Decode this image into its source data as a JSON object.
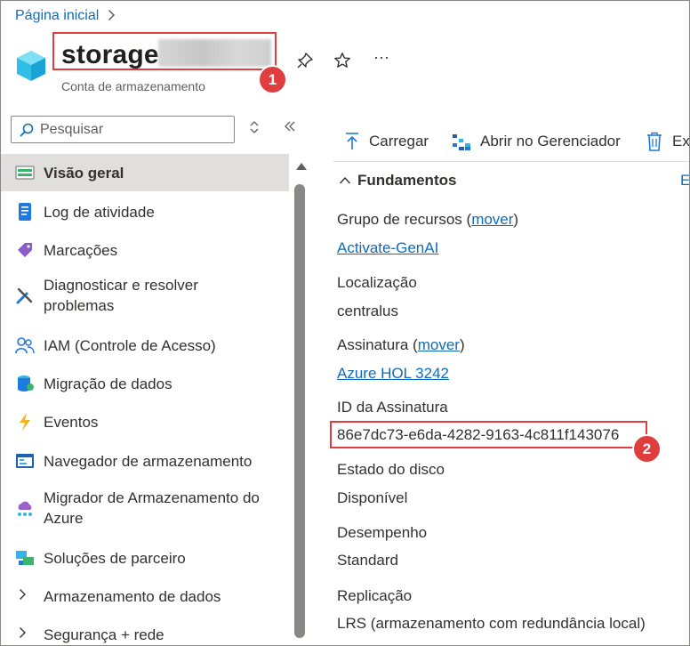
{
  "breadcrumb": {
    "home": "Página inicial"
  },
  "header": {
    "title": "storage",
    "subtitle": "Conta de armazenamento",
    "more_label": "···",
    "badges": [
      "1",
      "2"
    ]
  },
  "colors": {
    "accent": "#0f6cbd",
    "highlight": "#e03e3e",
    "active_bg": "#e1dfdd"
  },
  "sidebar": {
    "search_placeholder": "Pesquisar",
    "items": [
      {
        "label": "Visão geral",
        "icon": "overview-icon"
      },
      {
        "label": "Log de atividade",
        "icon": "activity-log-icon"
      },
      {
        "label": "Marcações",
        "icon": "tag-icon"
      },
      {
        "label": "Diagnosticar e resolver problemas",
        "icon": "wrench-icon"
      },
      {
        "label": "IAM (Controle de Acesso)",
        "icon": "people-icon"
      },
      {
        "label": "Migração de dados",
        "icon": "data-migration-icon"
      },
      {
        "label": "Eventos",
        "icon": "lightning-icon"
      },
      {
        "label": "Navegador de armazenamento",
        "icon": "storage-browser-icon"
      },
      {
        "label": "Migrador de Armazenamento do Azure",
        "icon": "cloud-migrator-icon"
      },
      {
        "label": "Soluções de parceiro",
        "icon": "partner-icon"
      },
      {
        "label": "Armazenamento de dados",
        "icon": "chevron-right-icon"
      },
      {
        "label": "Segurança + rede",
        "icon": "chevron-right-icon"
      }
    ]
  },
  "toolbar": {
    "upload": "Carregar",
    "open_explorer": "Abrir no Gerenciador",
    "delete": "Ex"
  },
  "essentials": {
    "title": "Fundamentos",
    "expand_label": "E",
    "move_link": "mover",
    "resource_group_label": "Grupo de recursos",
    "resource_group_value": "Activate-GenAI",
    "location_label": "Localização",
    "location_value": "centralus",
    "subscription_label": "Assinatura",
    "subscription_value": "Azure HOL 3242",
    "subscription_id_label": "ID da Assinatura",
    "subscription_id_value": "86e7dc73-e6da-4282-9163-4c811f143076",
    "disk_state_label": "Estado do disco",
    "disk_state_value": "Disponível",
    "performance_label": "Desempenho",
    "performance_value": "Standard",
    "replication_label": "Replicação",
    "replication_value": "LRS (armazenamento com redundância local)"
  }
}
